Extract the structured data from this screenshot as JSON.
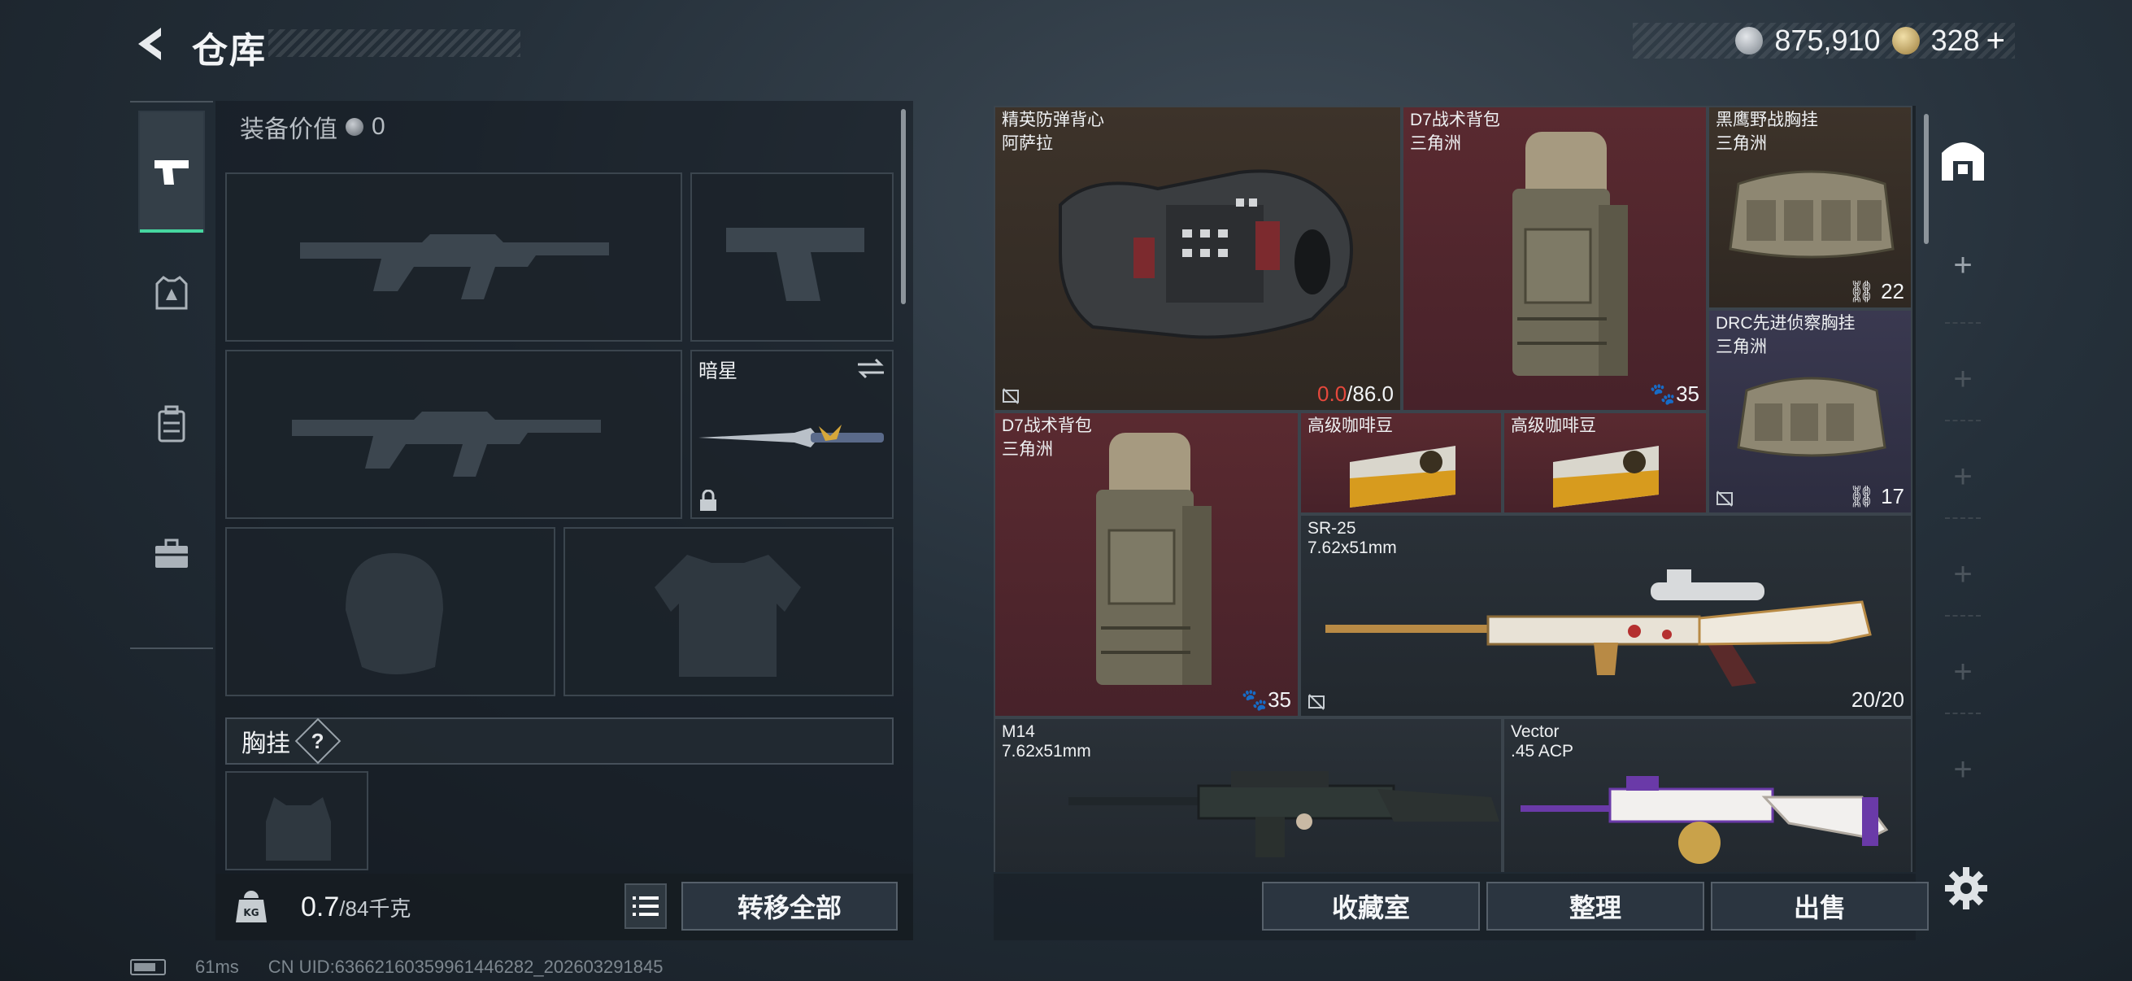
{
  "header": {
    "title": "仓库"
  },
  "currency": {
    "silver": "875,910",
    "gold": "328",
    "add_label": "+"
  },
  "left_tabs": [
    {
      "icon": "pistol-icon",
      "active": true
    },
    {
      "icon": "armor-icon",
      "active": false
    },
    {
      "icon": "backpack-icon",
      "active": false
    },
    {
      "icon": "briefcase-icon",
      "active": false
    }
  ],
  "equipment": {
    "value_label": "装备价值",
    "value": "0",
    "melee_slot": {
      "name": "暗星"
    },
    "section_vest": {
      "label": "胸挂",
      "help": "?"
    }
  },
  "weight": {
    "current": "0.7",
    "max": "/84千克"
  },
  "buttons": {
    "transfer_all": "转移全部",
    "collection": "收藏室",
    "organize": "整理",
    "sell": "出售"
  },
  "storage": {
    "items": [
      {
        "name": "精英防弹背心",
        "sub": "阿萨拉",
        "durability_current": "0.0",
        "durability_max": "/86.0",
        "rarity_color": "#3d332a"
      },
      {
        "name": "D7战术背包",
        "sub": "三角洲",
        "count": "35",
        "rarity_color": "#5a2a30"
      },
      {
        "name": "黑鹰野战胸挂",
        "sub": "三角洲",
        "count": "22",
        "rarity_color": "#3d332a"
      },
      {
        "name": "DRC先进侦察胸挂",
        "sub": "三角洲",
        "count": "17",
        "rarity_color": "#3a3950"
      },
      {
        "name": "D7战术背包",
        "sub": "三角洲",
        "count": "35",
        "rarity_color": "#5a2a30"
      },
      {
        "name": "高级咖啡豆",
        "rarity_color": "#5a2a30"
      },
      {
        "name": "高级咖啡豆",
        "rarity_color": "#5a2a30"
      },
      {
        "name": "SR-25",
        "sub": "7.62x51mm",
        "ammo": "20/20",
        "rarity_color": "#2a3138"
      },
      {
        "name": "M14",
        "sub": "7.62x51mm",
        "rarity_color": "#2a3138"
      },
      {
        "name": "Vector",
        "sub": ".45 ACP",
        "rarity_color": "#2a3138"
      }
    ]
  },
  "status_bar": {
    "ping": "61ms",
    "uid": "CN UID:636621603599614462​82_202603291845"
  }
}
